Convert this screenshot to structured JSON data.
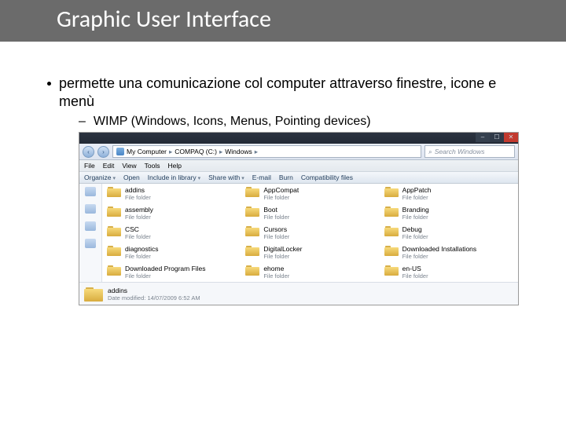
{
  "slide": {
    "title": "Graphic User Interface",
    "bullet": "permette una comunicazione col computer attraverso finestre, icone e menù",
    "sub_bullet": "WIMP (Windows, Icons, Menus, Pointing devices)"
  },
  "explorer": {
    "breadcrumb": {
      "root": "My Computer",
      "disk": "COMPAQ (C:)",
      "folder": "Windows"
    },
    "search_placeholder": "Search Windows",
    "menu": {
      "file": "File",
      "edit": "Edit",
      "view": "View",
      "tools": "Tools",
      "help": "Help"
    },
    "toolbar": {
      "organize": "Organize",
      "open": "Open",
      "include": "Include in library",
      "share": "Share with",
      "email": "E-mail",
      "burn": "Burn",
      "compat": "Compatibility files"
    },
    "folder_type": "File folder",
    "folders": {
      "r0c0": "addins",
      "r0c1": "AppCompat",
      "r0c2": "AppPatch",
      "r1c0": "assembly",
      "r1c1": "Boot",
      "r1c2": "Branding",
      "r2c0": "CSC",
      "r2c1": "Cursors",
      "r2c2": "Debug",
      "r3c0": "diagnostics",
      "r3c1": "DigitalLocker",
      "r3c2": "Downloaded Installations",
      "r4c0": "Downloaded Program Files",
      "r4c1": "ehome",
      "r4c2": "en-US"
    },
    "details": {
      "name": "addins",
      "meta": "Date modified: 14/07/2009 6:52 AM"
    }
  }
}
